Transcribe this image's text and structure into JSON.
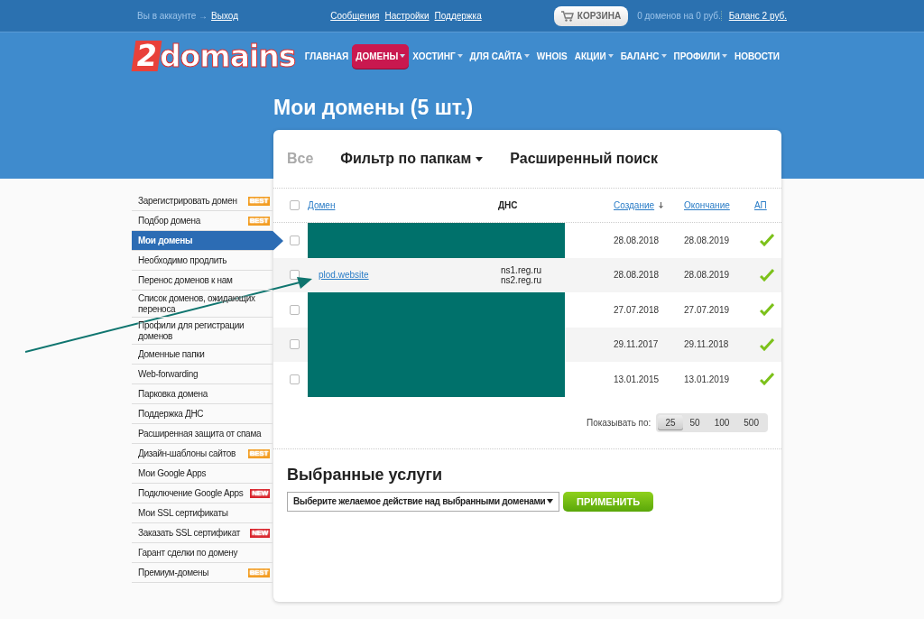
{
  "topbar": {
    "account_text": "Вы в аккаунте →",
    "logout": "Выход",
    "links": [
      "Сообщения",
      "Настройки",
      "Поддержка"
    ],
    "cart": "КОРЗИНА",
    "cart_summary": "0 доменов на 0 руб.",
    "balance": "Баланс 2 руб."
  },
  "logo": {
    "digit": "2",
    "text": "domains"
  },
  "nav": [
    {
      "label": "ГЛАВНАЯ",
      "selected": false,
      "has_menu": false
    },
    {
      "label": "ДОМЕНЫ",
      "selected": true,
      "has_menu": true
    },
    {
      "label": "ХОСТИНГ",
      "selected": false,
      "has_menu": true
    },
    {
      "label": "ДЛЯ САЙТА",
      "selected": false,
      "has_menu": true
    },
    {
      "label": "WHOIS",
      "selected": false,
      "has_menu": false
    },
    {
      "label": "АКЦИИ",
      "selected": false,
      "has_menu": true
    },
    {
      "label": "БАЛАНС",
      "selected": false,
      "has_menu": true
    },
    {
      "label": "ПРОФИЛИ",
      "selected": false,
      "has_menu": true
    },
    {
      "label": "НОВОСТИ",
      "selected": false,
      "has_menu": false
    }
  ],
  "page_title": "Мои домены (5 шт.)",
  "sidebar": [
    {
      "label": "Зарегистрировать домен",
      "selected": false,
      "badge": "BEST"
    },
    {
      "label": "Подбор домена",
      "selected": false,
      "badge": "BEST"
    },
    {
      "label": "Мои домены",
      "selected": true
    },
    {
      "label": "Необходимо продлить",
      "selected": false
    },
    {
      "label": "Перенос доменов к нам",
      "selected": false
    },
    {
      "label": "Список доменов, ожидающих переноса",
      "selected": false
    },
    {
      "label": "Профили для регистрации доменов",
      "selected": false
    },
    {
      "label": "Доменные папки",
      "selected": false
    },
    {
      "label": "Web-forwarding",
      "selected": false
    },
    {
      "label": "Парковка домена",
      "selected": false
    },
    {
      "label": "Поддержка ДНС",
      "selected": false
    },
    {
      "label": "Расширенная защита от спама",
      "selected": false
    },
    {
      "label": "Дизайн-шаблоны сайтов",
      "selected": false,
      "badge": "BEST"
    },
    {
      "label": "Мои Google Apps",
      "selected": false
    },
    {
      "label": "Подключение Google Apps",
      "selected": false,
      "badge": "NEW"
    },
    {
      "label": "Мои SSL сертификаты",
      "selected": false
    },
    {
      "label": "Заказать SSL сертификат",
      "selected": false,
      "badge": "NEW"
    },
    {
      "label": "Гарант сделки по домену",
      "selected": false
    },
    {
      "label": "Премиум-домены",
      "selected": false,
      "badge": "BEST"
    }
  ],
  "filter_tabs": [
    {
      "label": "Все",
      "selected": true,
      "has_menu": false
    },
    {
      "label": "Фильтр по папкам",
      "selected": false,
      "has_menu": true
    },
    {
      "label": "Расширенный поиск",
      "selected": false,
      "has_menu": false
    }
  ],
  "table": {
    "select_all_checked": false,
    "columns": [
      {
        "label": "Домен",
        "link": true,
        "sorted": false
      },
      {
        "label": "ДНС",
        "link": false,
        "sorted": false
      },
      {
        "label": "Создание",
        "link": true,
        "sorted": true
      },
      {
        "label": "Окончание",
        "link": true,
        "sorted": false
      },
      {
        "label": "АП",
        "link": true,
        "sorted": false
      }
    ],
    "rows": [
      {
        "checked": false,
        "redacted": true,
        "created": "28.08.2018",
        "expires": "28.08.2019",
        "autorenew": true
      },
      {
        "checked": false,
        "redacted": false,
        "domain": "plod.website",
        "dns": [
          "ns1.reg.ru",
          "ns2.reg.ru"
        ],
        "created": "28.08.2018",
        "expires": "28.08.2019",
        "autorenew": true
      },
      {
        "checked": false,
        "redacted": true,
        "created": "27.07.2018",
        "expires": "27.07.2019",
        "autorenew": true
      },
      {
        "checked": false,
        "redacted": true,
        "created": "29.11.2017",
        "expires": "29.11.2018",
        "autorenew": true
      },
      {
        "checked": false,
        "redacted": true,
        "created": "13.01.2015",
        "expires": "13.01.2019",
        "autorenew": true
      }
    ]
  },
  "per_page": {
    "label": "Показывать по:",
    "options": [
      {
        "label": "25",
        "selected": true
      },
      {
        "label": "50",
        "selected": false
      },
      {
        "label": "100",
        "selected": false
      },
      {
        "label": "500",
        "selected": false
      }
    ]
  },
  "services": {
    "title": "Выбранные услуги",
    "select": "Выберите желаемое действие над выбранными доменами",
    "apply": "ПРИМЕНИТЬ"
  }
}
